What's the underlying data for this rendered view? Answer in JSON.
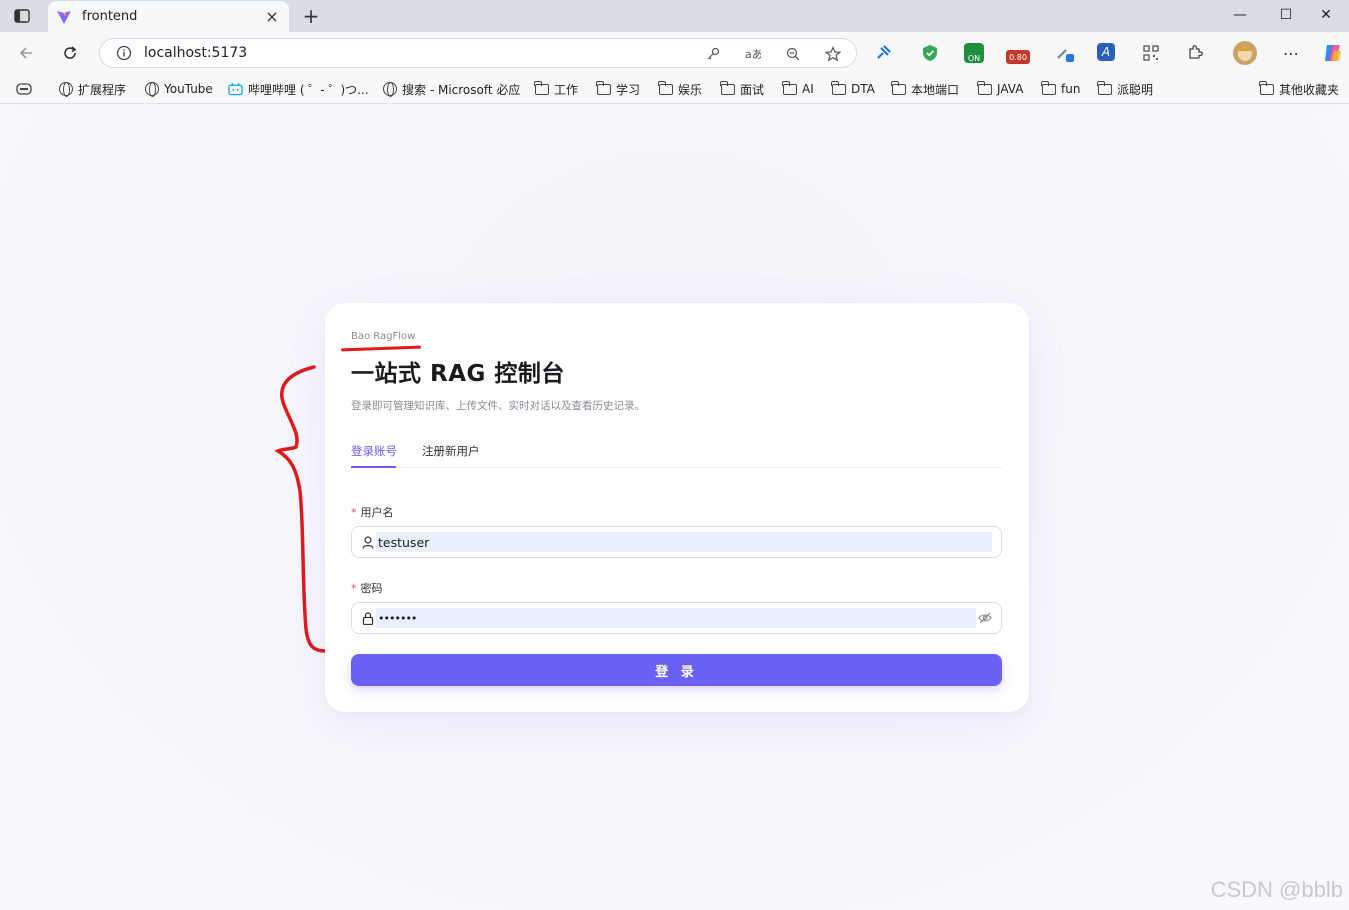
{
  "browser": {
    "tab_title": "frontend",
    "tab_close": "×",
    "new_tab": "+",
    "url": "localhost:5173",
    "controls": {
      "minimize": "—",
      "maximize": "☐",
      "close": "✕"
    },
    "extensions": [
      {
        "name": "pin-extension-icon",
        "color": "#1b7bd1",
        "label": ""
      },
      {
        "name": "shield-extension-icon",
        "color": "#3aa655",
        "label": ""
      },
      {
        "name": "on-extension-icon",
        "color": "#1e8f3c",
        "label": "ON"
      },
      {
        "name": "badge-extension-icon",
        "color": "#c0392b",
        "label": "0.80"
      },
      {
        "name": "dropper-extension-icon",
        "color": "#2a78e4",
        "label": ""
      },
      {
        "name": "translate-extension-icon",
        "color": "#2b5fb5",
        "label": "A"
      },
      {
        "name": "qr-extension-icon",
        "color": "#555555",
        "label": ""
      }
    ],
    "bookmarks": [
      {
        "label": "扩展程序",
        "icon": "globe"
      },
      {
        "label": "YouTube",
        "icon": "globe"
      },
      {
        "label": "哔哩哔哩 ( ゜- ゜)つ...",
        "icon": "bilibili"
      },
      {
        "label": "搜索 - Microsoft 必应",
        "icon": "globe"
      },
      {
        "label": "工作",
        "icon": "folder"
      },
      {
        "label": "学习",
        "icon": "folder"
      },
      {
        "label": "娱乐",
        "icon": "folder"
      },
      {
        "label": "面试",
        "icon": "folder"
      },
      {
        "label": "AI",
        "icon": "folder"
      },
      {
        "label": "DTA",
        "icon": "folder"
      },
      {
        "label": "本地端口",
        "icon": "folder"
      },
      {
        "label": "JAVA",
        "icon": "folder"
      },
      {
        "label": "fun",
        "icon": "folder"
      },
      {
        "label": "派聪明",
        "icon": "folder"
      }
    ],
    "other_bookmarks": "其他收藏夹"
  },
  "login": {
    "brand": "Bao RagFlow",
    "title": "一站式 RAG 控制台",
    "subtitle": "登录即可管理知识库、上传文件、实时对话以及查看历史记录。",
    "tabs": {
      "login": "登录账号",
      "register": "注册新用户"
    },
    "username": {
      "required_mark": "*",
      "label": "用户名",
      "value": "testuser"
    },
    "password": {
      "required_mark": "*",
      "label": "密码",
      "value": "•••••••"
    },
    "submit": "登 录"
  },
  "colors": {
    "accent": "#6c5ff4",
    "annotation": "#e01a1a"
  },
  "watermark": "CSDN @bblb"
}
